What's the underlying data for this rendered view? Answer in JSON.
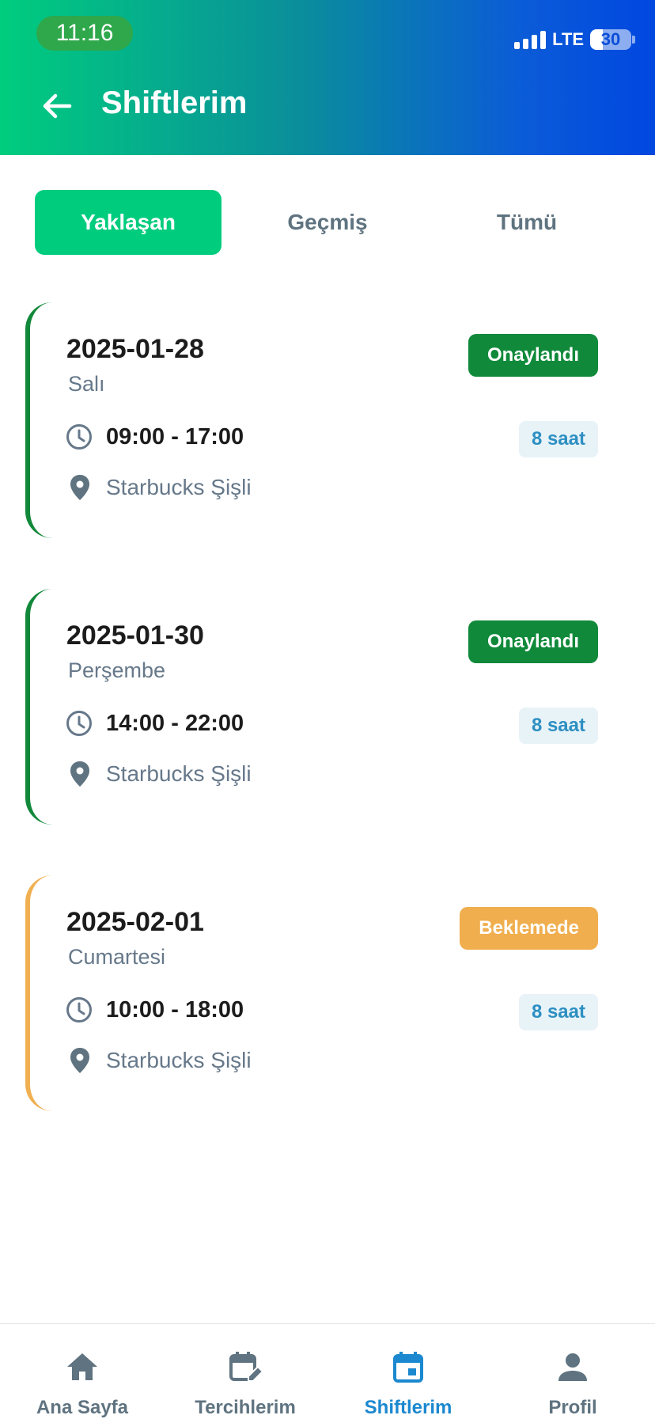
{
  "status_bar": {
    "time": "11:16",
    "network": "LTE",
    "battery_level": "30"
  },
  "header": {
    "title": "Shiftlerim",
    "back_icon": "arrow-left-icon"
  },
  "tabs": [
    {
      "label": "Yaklaşan",
      "active": true
    },
    {
      "label": "Geçmiş",
      "active": false
    },
    {
      "label": "Tümü",
      "active": false
    }
  ],
  "shifts": [
    {
      "date": "2025-01-28",
      "day": "Salı",
      "status": "Onaylandı",
      "time": "09:00 - 17:00",
      "hours": "8 saat",
      "location": "Starbucks Şişli"
    },
    {
      "date": "2025-01-30",
      "day": "Perşembe",
      "status": "Onaylandı",
      "time": "14:00 - 22:00",
      "hours": "8 saat",
      "location": "Starbucks Şişli"
    },
    {
      "date": "2025-02-01",
      "day": "Cumartesi",
      "status": "Beklemede",
      "time": "10:00 - 18:00",
      "hours": "8 saat",
      "location": "Starbucks Şişli"
    }
  ],
  "bottom_nav": [
    {
      "label": "Ana Sayfa",
      "icon": "home-icon"
    },
    {
      "label": "Tercihlerim",
      "icon": "calendar-edit-icon"
    },
    {
      "label": "Shiftlerim",
      "icon": "calendar-icon",
      "active": true
    },
    {
      "label": "Profil",
      "icon": "person-icon"
    }
  ],
  "colors": {
    "header_gradient_start": "#00cd7e",
    "header_gradient_end": "#0047e0",
    "accent": "#00cc7d",
    "approved": "#108a3a",
    "pending": "#f0ae4e",
    "nav_active": "#1b88cf"
  }
}
